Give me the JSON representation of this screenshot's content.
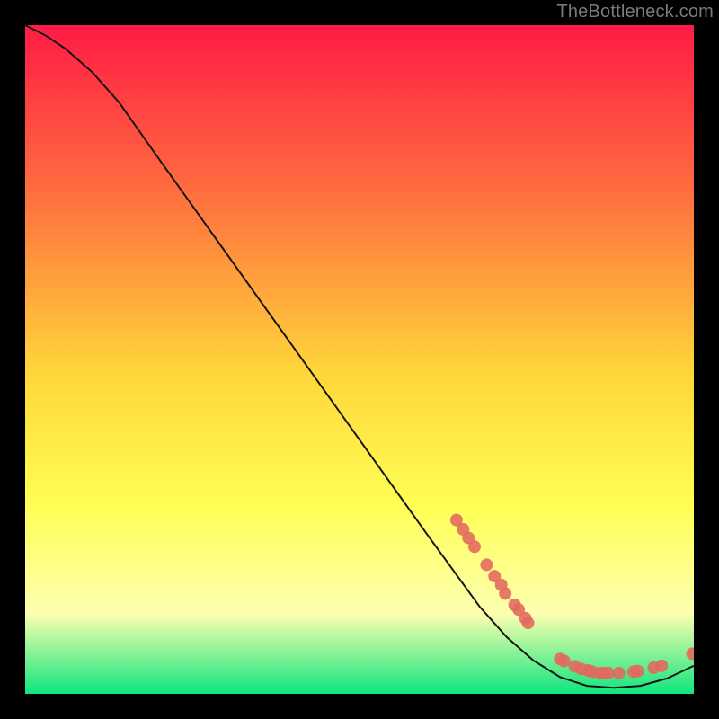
{
  "attribution": "TheBottleneck.com",
  "colors": {
    "marker": "#e2685d",
    "curve": "#151515",
    "gradient_top": "#ff1b45",
    "gradient_mid1": "#ff6a3f",
    "gradient_mid2": "#ffd63a",
    "gradient_mid3": "#ffff55",
    "gradient_mid4": "#fdffb0",
    "gradient_bottom": "#0fe57e"
  },
  "chart_data": {
    "type": "line",
    "title": "",
    "xlabel": "",
    "ylabel": "",
    "xlim": [
      0,
      100
    ],
    "ylim": [
      0,
      100
    ],
    "curve": [
      {
        "x": 0,
        "y": 100
      },
      {
        "x": 3,
        "y": 98.5
      },
      {
        "x": 6,
        "y": 96.5
      },
      {
        "x": 10,
        "y": 93
      },
      {
        "x": 14,
        "y": 88.5
      },
      {
        "x": 20,
        "y": 80
      },
      {
        "x": 30,
        "y": 66
      },
      {
        "x": 40,
        "y": 52
      },
      {
        "x": 50,
        "y": 38
      },
      {
        "x": 60,
        "y": 24
      },
      {
        "x": 68,
        "y": 13
      },
      {
        "x": 72,
        "y": 8.5
      },
      {
        "x": 76,
        "y": 5
      },
      {
        "x": 80,
        "y": 2.5
      },
      {
        "x": 84,
        "y": 1.2
      },
      {
        "x": 88,
        "y": 0.9
      },
      {
        "x": 92,
        "y": 1.2
      },
      {
        "x": 96,
        "y": 2.3
      },
      {
        "x": 100,
        "y": 4.2
      }
    ],
    "markers": [
      {
        "x": 64.5,
        "y": 26.0
      },
      {
        "x": 65.5,
        "y": 24.6
      },
      {
        "x": 66.3,
        "y": 23.3
      },
      {
        "x": 67.2,
        "y": 22.0
      },
      {
        "x": 69.0,
        "y": 19.3
      },
      {
        "x": 70.2,
        "y": 17.6
      },
      {
        "x": 71.2,
        "y": 16.3
      },
      {
        "x": 71.8,
        "y": 15.0
      },
      {
        "x": 73.2,
        "y": 13.3
      },
      {
        "x": 73.8,
        "y": 12.6
      },
      {
        "x": 74.8,
        "y": 11.3
      },
      {
        "x": 75.2,
        "y": 10.6
      },
      {
        "x": 80.0,
        "y": 5.2
      },
      {
        "x": 80.6,
        "y": 4.9
      },
      {
        "x": 82.2,
        "y": 4.1
      },
      {
        "x": 83.2,
        "y": 3.7
      },
      {
        "x": 84.2,
        "y": 3.5
      },
      {
        "x": 84.8,
        "y": 3.3
      },
      {
        "x": 86.0,
        "y": 3.1
      },
      {
        "x": 86.5,
        "y": 3.1
      },
      {
        "x": 87.2,
        "y": 3.1
      },
      {
        "x": 88.8,
        "y": 3.1
      },
      {
        "x": 91.0,
        "y": 3.3
      },
      {
        "x": 91.6,
        "y": 3.4
      },
      {
        "x": 94.0,
        "y": 3.9
      },
      {
        "x": 95.2,
        "y": 4.2
      },
      {
        "x": 99.8,
        "y": 6.0
      }
    ]
  }
}
